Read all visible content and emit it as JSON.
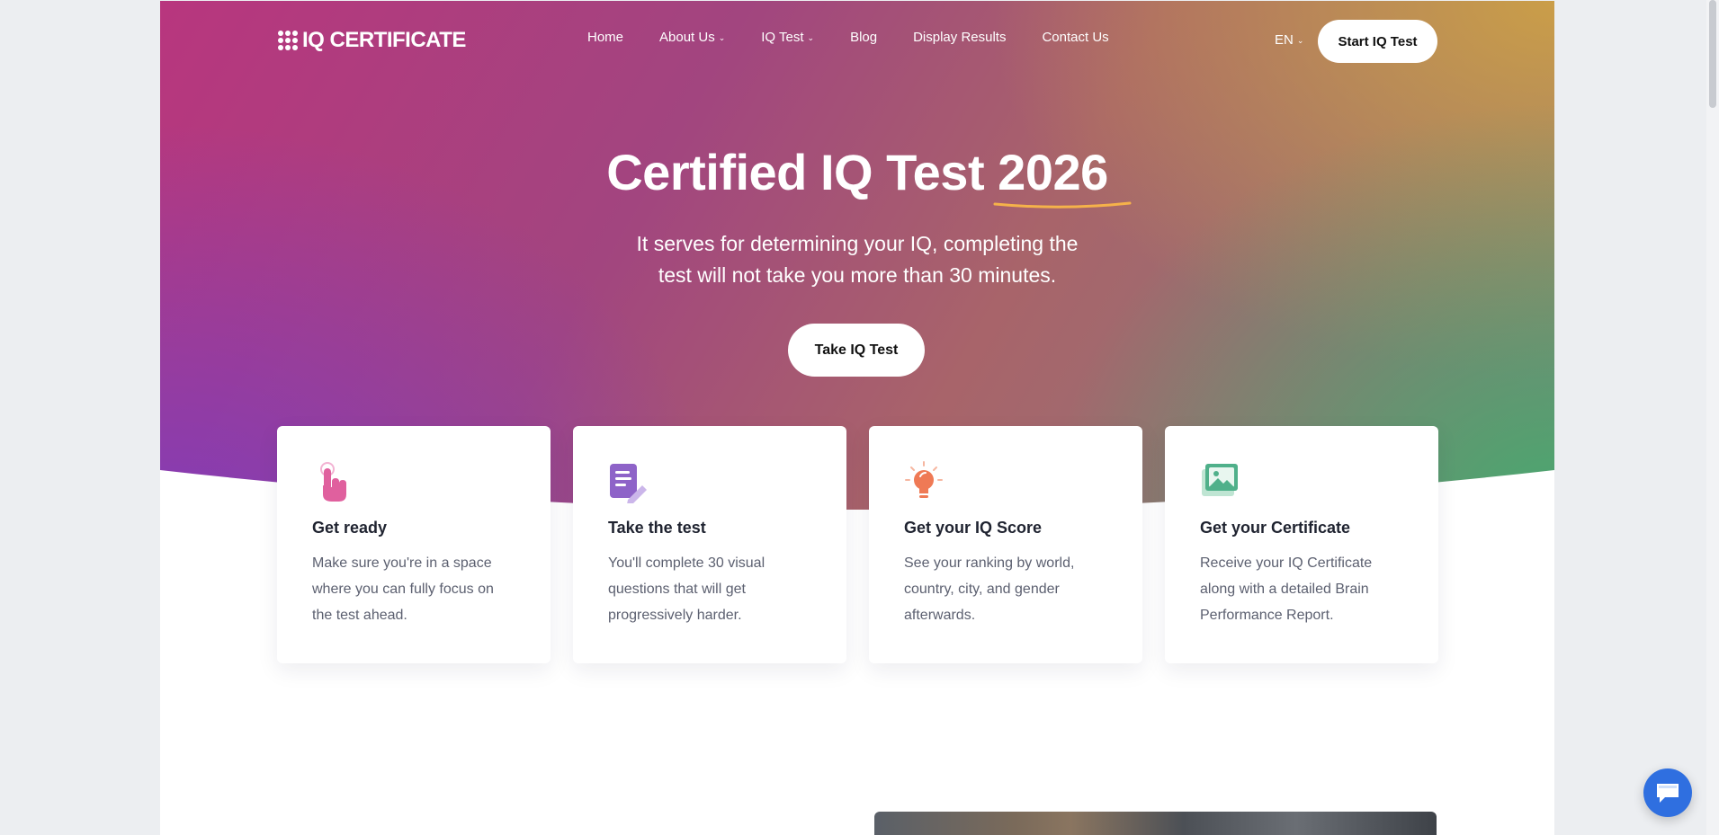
{
  "header": {
    "logo_text": "IQ CERTIFICATE",
    "nav": [
      {
        "label": "Home",
        "has_dropdown": false
      },
      {
        "label": "About Us",
        "has_dropdown": true
      },
      {
        "label": "IQ Test",
        "has_dropdown": true
      },
      {
        "label": "Blog",
        "has_dropdown": false
      },
      {
        "label": "Display Results",
        "has_dropdown": false
      },
      {
        "label": "Contact Us",
        "has_dropdown": false
      }
    ],
    "language": "EN",
    "cta_label": "Start IQ Test"
  },
  "hero": {
    "title_main": "Certified IQ Test",
    "title_year": "2026",
    "subtitle_line1": "It serves for determining your IQ, completing the",
    "subtitle_line2": "test will not take you more than 30 minutes.",
    "cta_label": "Take IQ Test"
  },
  "steps": [
    {
      "icon": "pointer-hand-icon",
      "title": "Get ready",
      "text": "Make sure you're in a space where you can fully focus on the test ahead."
    },
    {
      "icon": "document-pen-icon",
      "title": "Take the test",
      "text": "You'll complete 30 visual questions that will get progressively harder."
    },
    {
      "icon": "lightbulb-icon",
      "title": "Get your IQ Score",
      "text": "See your ranking by world, country, city, and gender afterwards."
    },
    {
      "icon": "certificate-image-icon",
      "title": "Get your Certificate",
      "text": "Receive your IQ Certificate along with a detailed Brain Performance Report."
    }
  ],
  "colors": {
    "accent_underline": "#f5b24a",
    "chat_button": "#2f6fe0",
    "icon_pink": "#e0609e",
    "icon_purple": "#8e63c8",
    "icon_orange": "#ef7a55",
    "icon_green": "#4fb08a"
  }
}
